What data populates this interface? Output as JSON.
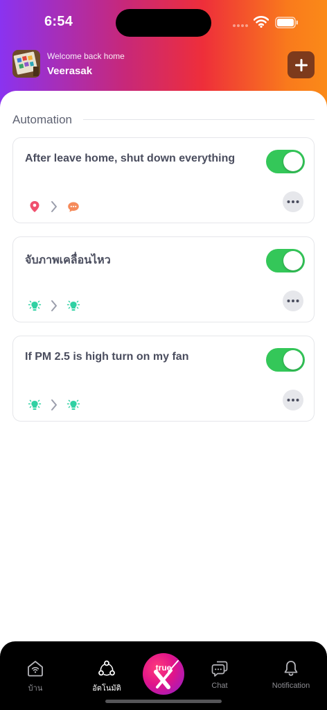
{
  "status_bar": {
    "time": "6:54"
  },
  "header": {
    "welcome_text": "Welcome back home",
    "username": "Veerasak",
    "add_icon": "plus-icon",
    "gradient": [
      "#8a33f0",
      "#ee2e3a",
      "#fb8a18"
    ]
  },
  "main": {
    "section_title": "Automation",
    "rules": [
      {
        "title": "After leave home, shut down everything",
        "enabled": true,
        "icons": [
          "location-pin-icon",
          "chevron-right-icon",
          "chat-bubble-icon"
        ]
      },
      {
        "title": "จับภาพเคลื่อนไหว",
        "enabled": true,
        "icons": [
          "light-bulb-icon",
          "chevron-right-icon",
          "light-bulb-icon"
        ]
      },
      {
        "title": "If PM 2.5 is high turn on my fan",
        "enabled": true,
        "icons": [
          "light-bulb-icon",
          "chevron-right-icon",
          "light-bulb-icon"
        ]
      }
    ]
  },
  "tabbar": {
    "tabs": [
      {
        "label": "บ้าน",
        "icon": "home-wifi-icon"
      },
      {
        "label": "อัตโนมัติ",
        "icon": "automation-icon"
      },
      {
        "label": "Chat",
        "icon": "chat-icon"
      },
      {
        "label": "Notification",
        "icon": "bell-icon"
      }
    ],
    "center_logo": "true",
    "active_tab": "อัตโนมัติ"
  },
  "colors": {
    "toggle_on": "#34c759",
    "accent_pin": "#f0506e",
    "accent_chat": "#f58a5a",
    "accent_bulb": "#2fd1a3",
    "add_button": "#7d3a1c"
  }
}
